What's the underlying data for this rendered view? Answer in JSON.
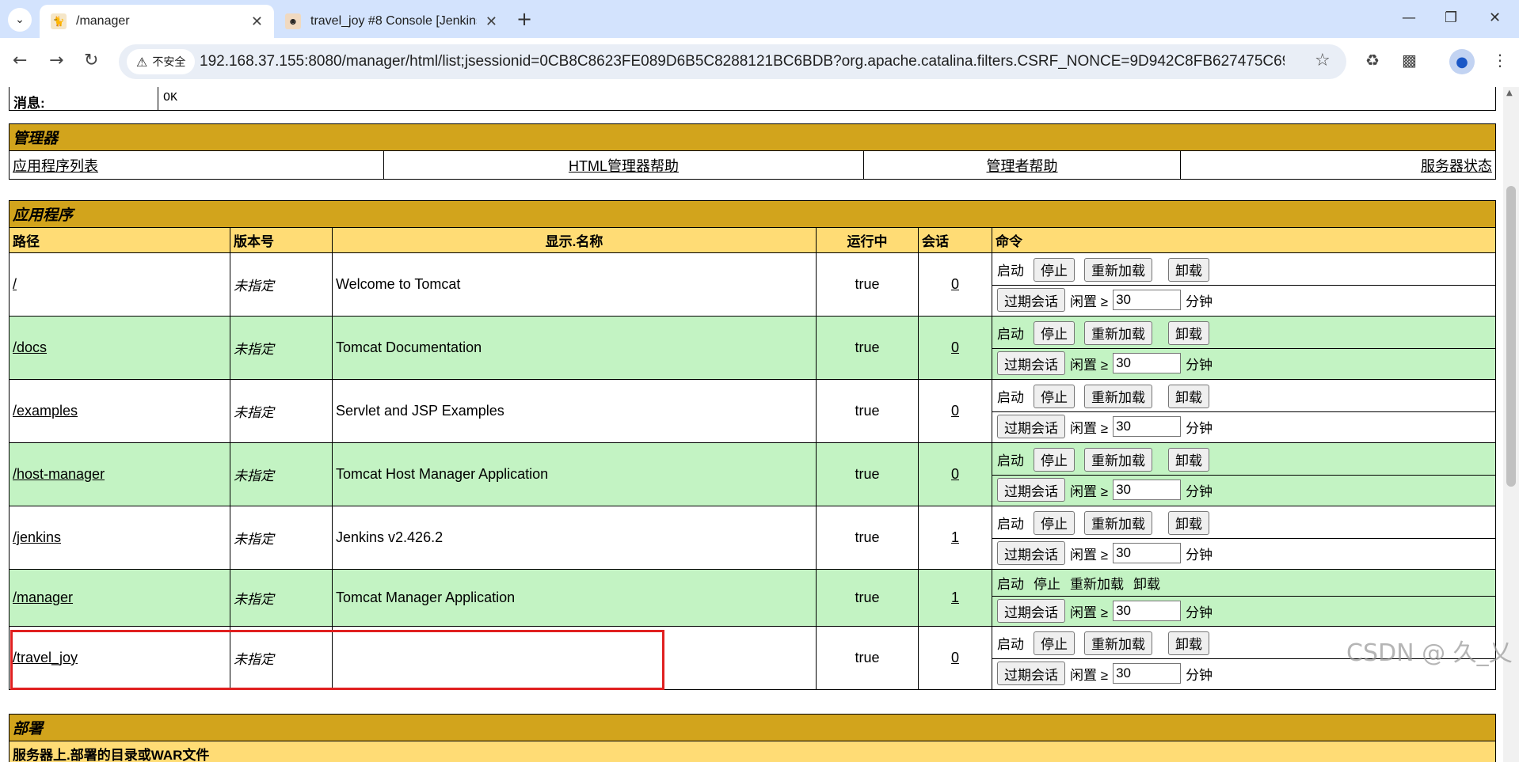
{
  "browser": {
    "tabs": [
      {
        "title": "/manager",
        "active": true
      },
      {
        "title": "travel_joy #8 Console [Jenkins]",
        "active": false
      }
    ],
    "security_label": "不安全",
    "url": "192.168.37.155:8080/manager/html/list;jsessionid=0CB8C8623FE089D6B5C8288121BC6BDB?org.apache.catalina.filters.CSRF_NONCE=9D942C8FB627475C69F7604D..."
  },
  "message": {
    "label": "消息:",
    "value": "OK"
  },
  "manager": {
    "title": "管理器",
    "links": [
      "应用程序列表",
      "HTML管理器帮助",
      "管理者帮助",
      "服务器状态"
    ]
  },
  "apps": {
    "title": "应用程序",
    "headers": [
      "路径",
      "版本号",
      "显示.名称",
      "运行中",
      "会话",
      "命令"
    ],
    "cmd_labels": {
      "start": "启动",
      "stop": "停止",
      "reload": "重新加载",
      "undeploy": "卸载",
      "expire": "过期会话",
      "idle": "闲置 ≥",
      "minutes": "分钟"
    },
    "rows": [
      {
        "path": "/",
        "version": "未指定",
        "name": "Welcome to Tomcat",
        "running": "true",
        "sessions": "0",
        "idle_value": "30"
      },
      {
        "path": "/docs",
        "version": "未指定",
        "name": "Tomcat Documentation",
        "running": "true",
        "sessions": "0",
        "idle_value": "30"
      },
      {
        "path": "/examples",
        "version": "未指定",
        "name": "Servlet and JSP Examples",
        "running": "true",
        "sessions": "0",
        "idle_value": "30"
      },
      {
        "path": "/host-manager",
        "version": "未指定",
        "name": "Tomcat Host Manager Application",
        "running": "true",
        "sessions": "0",
        "idle_value": "30"
      },
      {
        "path": "/jenkins",
        "version": "未指定",
        "name": "Jenkins v2.426.2",
        "running": "true",
        "sessions": "1",
        "idle_value": "30"
      },
      {
        "path": "/manager",
        "version": "未指定",
        "name": "Tomcat Manager Application",
        "running": "true",
        "sessions": "1",
        "idle_value": "30"
      },
      {
        "path": "/travel_joy",
        "version": "未指定",
        "name": "",
        "running": "true",
        "sessions": "0",
        "idle_value": "30"
      }
    ]
  },
  "deploy": {
    "title": "部署",
    "subtitle": "服务器上.部署的目录或WAR文件"
  },
  "watermark": "CSDN @ 久_乂"
}
